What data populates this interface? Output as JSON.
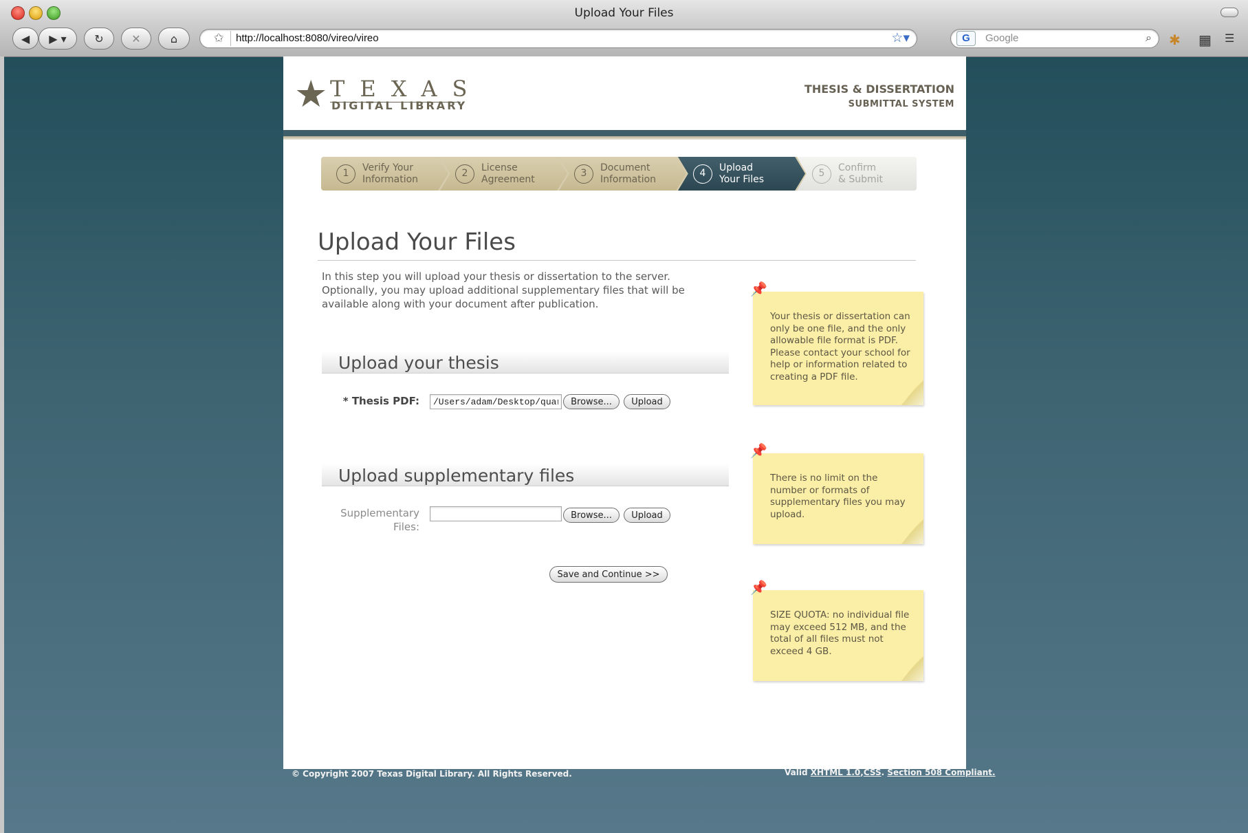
{
  "window": {
    "title": "Upload Your Files"
  },
  "browser": {
    "url": "http://localhost:8080/vireo/vireo",
    "search_engine_label": "G",
    "search_placeholder": "Google"
  },
  "header": {
    "logo_line1": "TEXAS",
    "logo_line2": "DIGITAL LIBRARY",
    "system_title": "THESIS & DISSERTATION",
    "system_subtitle": "SUBMITTAL SYSTEM"
  },
  "steps": [
    {
      "num": "1",
      "line1": "Verify Your",
      "line2": "Information",
      "state": "done"
    },
    {
      "num": "2",
      "line1": "License",
      "line2": "Agreement",
      "state": "done"
    },
    {
      "num": "3",
      "line1": "Document",
      "line2": "Information",
      "state": "done"
    },
    {
      "num": "4",
      "line1": "Upload",
      "line2": "Your Files",
      "state": "active"
    },
    {
      "num": "5",
      "line1": "Confirm",
      "line2": "& Submit",
      "state": "todo"
    }
  ],
  "main": {
    "title": "Upload Your Files",
    "intro": "In this step you will upload your thesis or dissertation to the server. Optionally, you may upload additional supplementary files that will be available along with your document after publication.",
    "thesis_section": {
      "title": "Upload your thesis",
      "label": "* Thesis PDF:",
      "value": "/Users/adam/Desktop/quar",
      "browse": "Browse...",
      "upload": "Upload"
    },
    "supp_section": {
      "title": "Upload supplementary files",
      "label_line1": "Supplementary",
      "label_line2": "Files:",
      "value": "",
      "browse": "Browse...",
      "upload": "Upload"
    },
    "save_button": "Save and Continue >>"
  },
  "notes": [
    "Your thesis or dissertation can only be one file, and the only allowable file format is PDF. Please contact your school for help or information related to creating a PDF file.",
    "There is no limit on the number or formats of supplementary files you may upload.",
    "SIZE QUOTA: no individual file may exceed 512 MB, and the total of all files must not exceed 4 GB."
  ],
  "footer": {
    "copyright": "© Copyright 2007 Texas Digital Library. All Rights Reserved.",
    "valid_prefix": "Valid ",
    "xhtml_link": "XHTML 1.0",
    "comma": ",",
    "css_link": "CSS",
    "period": ". ",
    "section508_link": "Section 508 Compliant."
  },
  "colors": {
    "page_bg": "#3d6371",
    "header_bar": "#3e5e6a",
    "step_active": "#2c4752",
    "step_done": "#c6b991",
    "note_bg": "#fbeea6"
  }
}
